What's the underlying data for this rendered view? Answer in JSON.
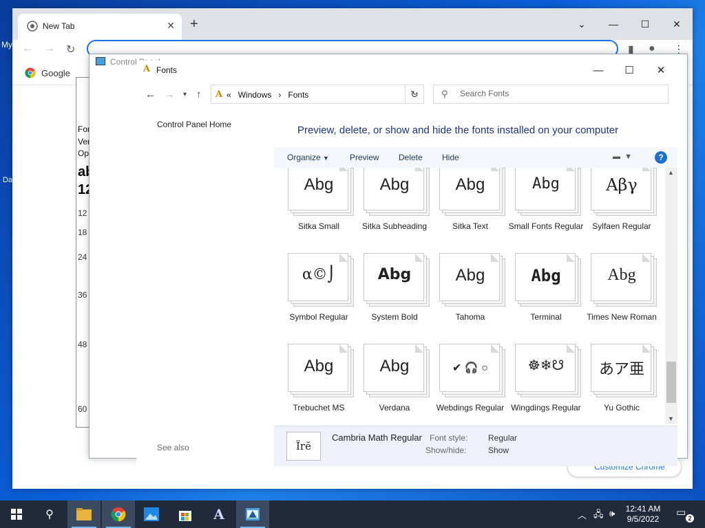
{
  "desktop": {
    "label_top": "My",
    "label_bottom": "Da"
  },
  "chrome": {
    "tab_title": "New Tab",
    "bookmark_label": "Google",
    "customize_label": "Customize Chrome"
  },
  "font_viewer": {
    "lines": [
      "Fon",
      "Ver",
      "Op"
    ],
    "sample_top": "ab",
    "sample_bottom": "12",
    "sizes": [
      "12",
      "18",
      "24",
      "36",
      "48",
      "60"
    ]
  },
  "control_panel": {
    "title": "Control Panel"
  },
  "fonts_window": {
    "title": "Fonts",
    "address": {
      "prefix": "«",
      "parts": [
        "Windows",
        "Fonts"
      ],
      "separator": "›"
    },
    "search_placeholder": "Search Fonts",
    "left_links": {
      "home": "Control Panel Home",
      "see_also": "See also"
    },
    "headline": "Preview, delete, or show and hide the fonts installed on your computer",
    "commands": {
      "organize": "Organize",
      "preview": "Preview",
      "delete": "Delete",
      "hide": "Hide",
      "help": "?"
    },
    "tiles": [
      {
        "name": "Sitka Small",
        "sample": "Abg"
      },
      {
        "name": "Sitka Subheading",
        "sample": "Abg"
      },
      {
        "name": "Sitka Text",
        "sample": "Abg"
      },
      {
        "name": "Small Fonts Regular",
        "sample": "Abg"
      },
      {
        "name": "Sylfaen Regular",
        "sample": "Αβγ"
      },
      {
        "name": "Symbol Regular",
        "sample": "α©⌡"
      },
      {
        "name": "System Bold",
        "sample": "Abg"
      },
      {
        "name": "Tahoma",
        "sample": "Abg"
      },
      {
        "name": "Terminal",
        "sample": "Abg"
      },
      {
        "name": "Times New Roman",
        "sample": "Abg"
      },
      {
        "name": "Trebuchet MS",
        "sample": "Abg"
      },
      {
        "name": "Verdana",
        "sample": "Abg"
      },
      {
        "name": "Webdings Regular",
        "sample": "✔ 🎧 ○"
      },
      {
        "name": "Wingdings Regular",
        "sample": "☸❄☋"
      },
      {
        "name": "Yu Gothic",
        "sample": "あア亜"
      }
    ],
    "details": {
      "thumb_sample": "Ïrĕ",
      "font_name": "Cambria Math Regular",
      "font_style_label": "Font style:",
      "font_style_value": "Regular",
      "show_hide_label": "Show/hide:",
      "show_hide_value": "Show"
    }
  },
  "taskbar": {
    "time": "12:41 AM",
    "date": "9/5/2022",
    "notification_count": "2"
  }
}
